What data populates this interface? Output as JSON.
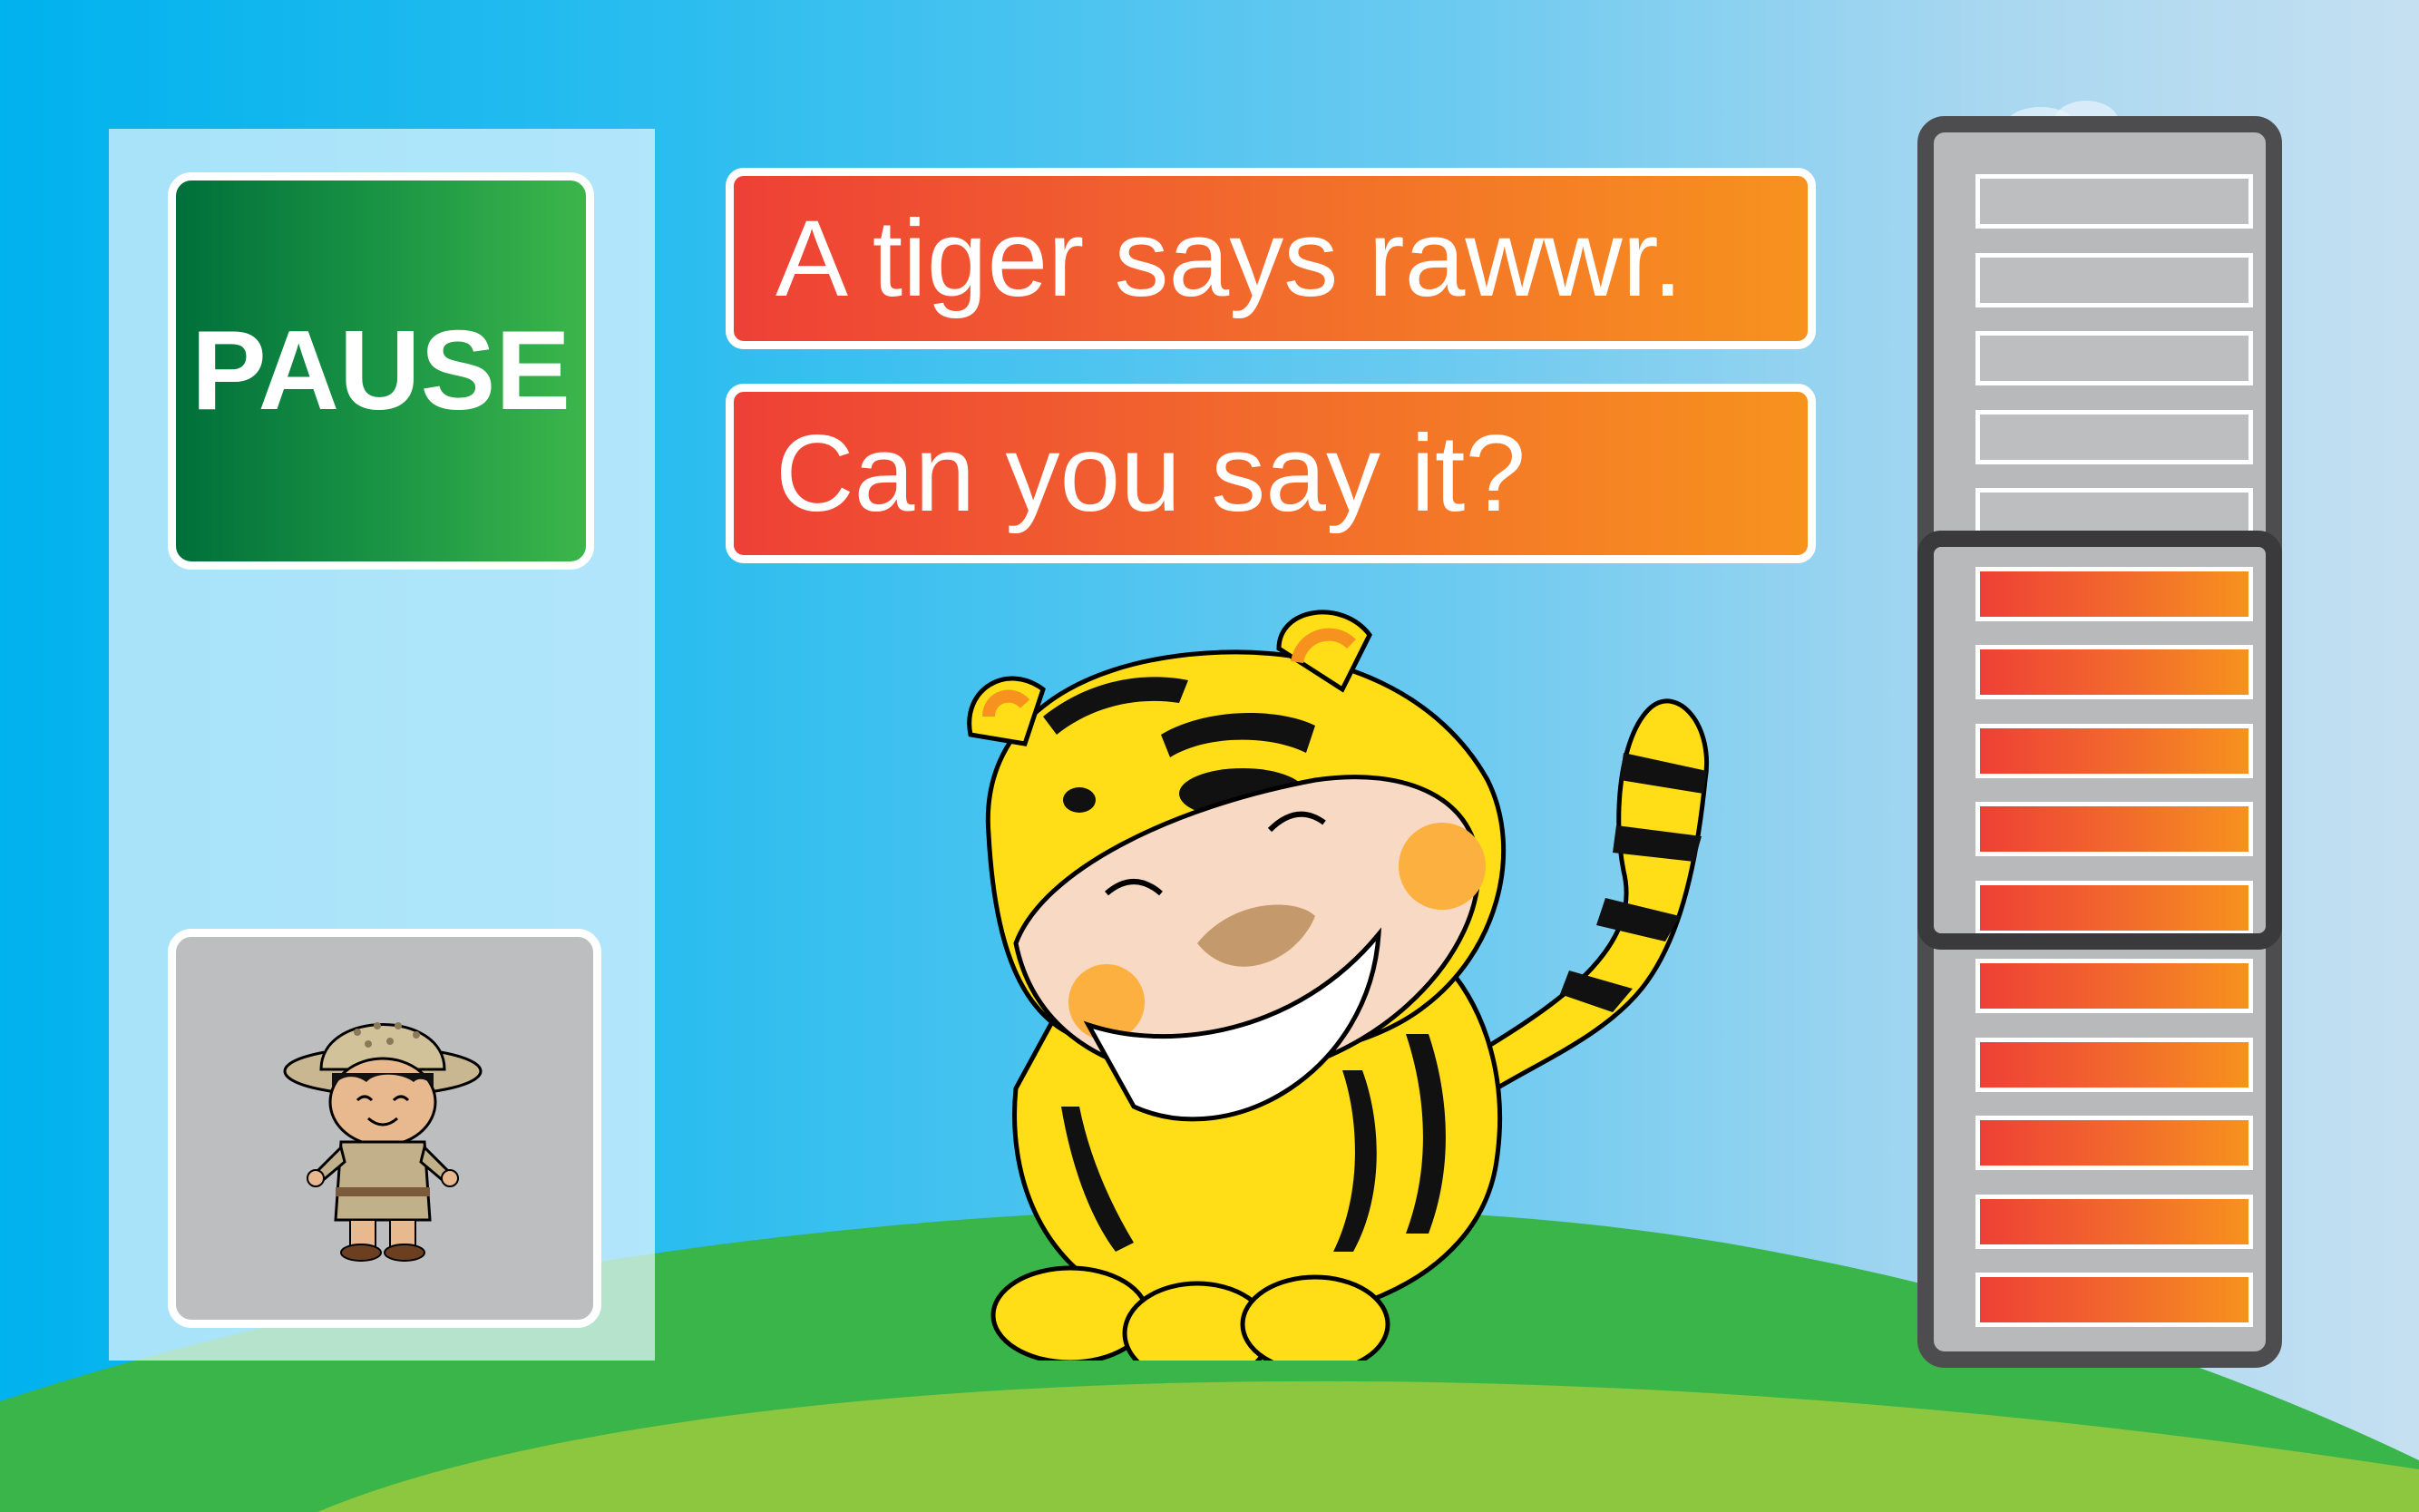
{
  "game": {
    "pause_label": "PAUSE",
    "prompt_line_1": "A tiger says rawwr.",
    "prompt_line_2": "Can you say it?"
  },
  "character": {
    "icon": "tiger-costume-kid-icon"
  },
  "player_avatar": {
    "icon": "safari-explorer-kid-icon"
  },
  "voice_meter": {
    "segments_total": 15,
    "segments_filled": 10,
    "target_range": [
      6,
      10
    ],
    "filled_color": "#ee4036",
    "empty_color": "#bcbec0"
  },
  "colors": {
    "sky_left": "#00b2ee",
    "sky_right": "#c5e0f1",
    "hill_dark": "#39b54a",
    "hill_light": "#8dc63f",
    "pause_button": "#1a9444",
    "prompt_orange": "#f26b2c"
  }
}
